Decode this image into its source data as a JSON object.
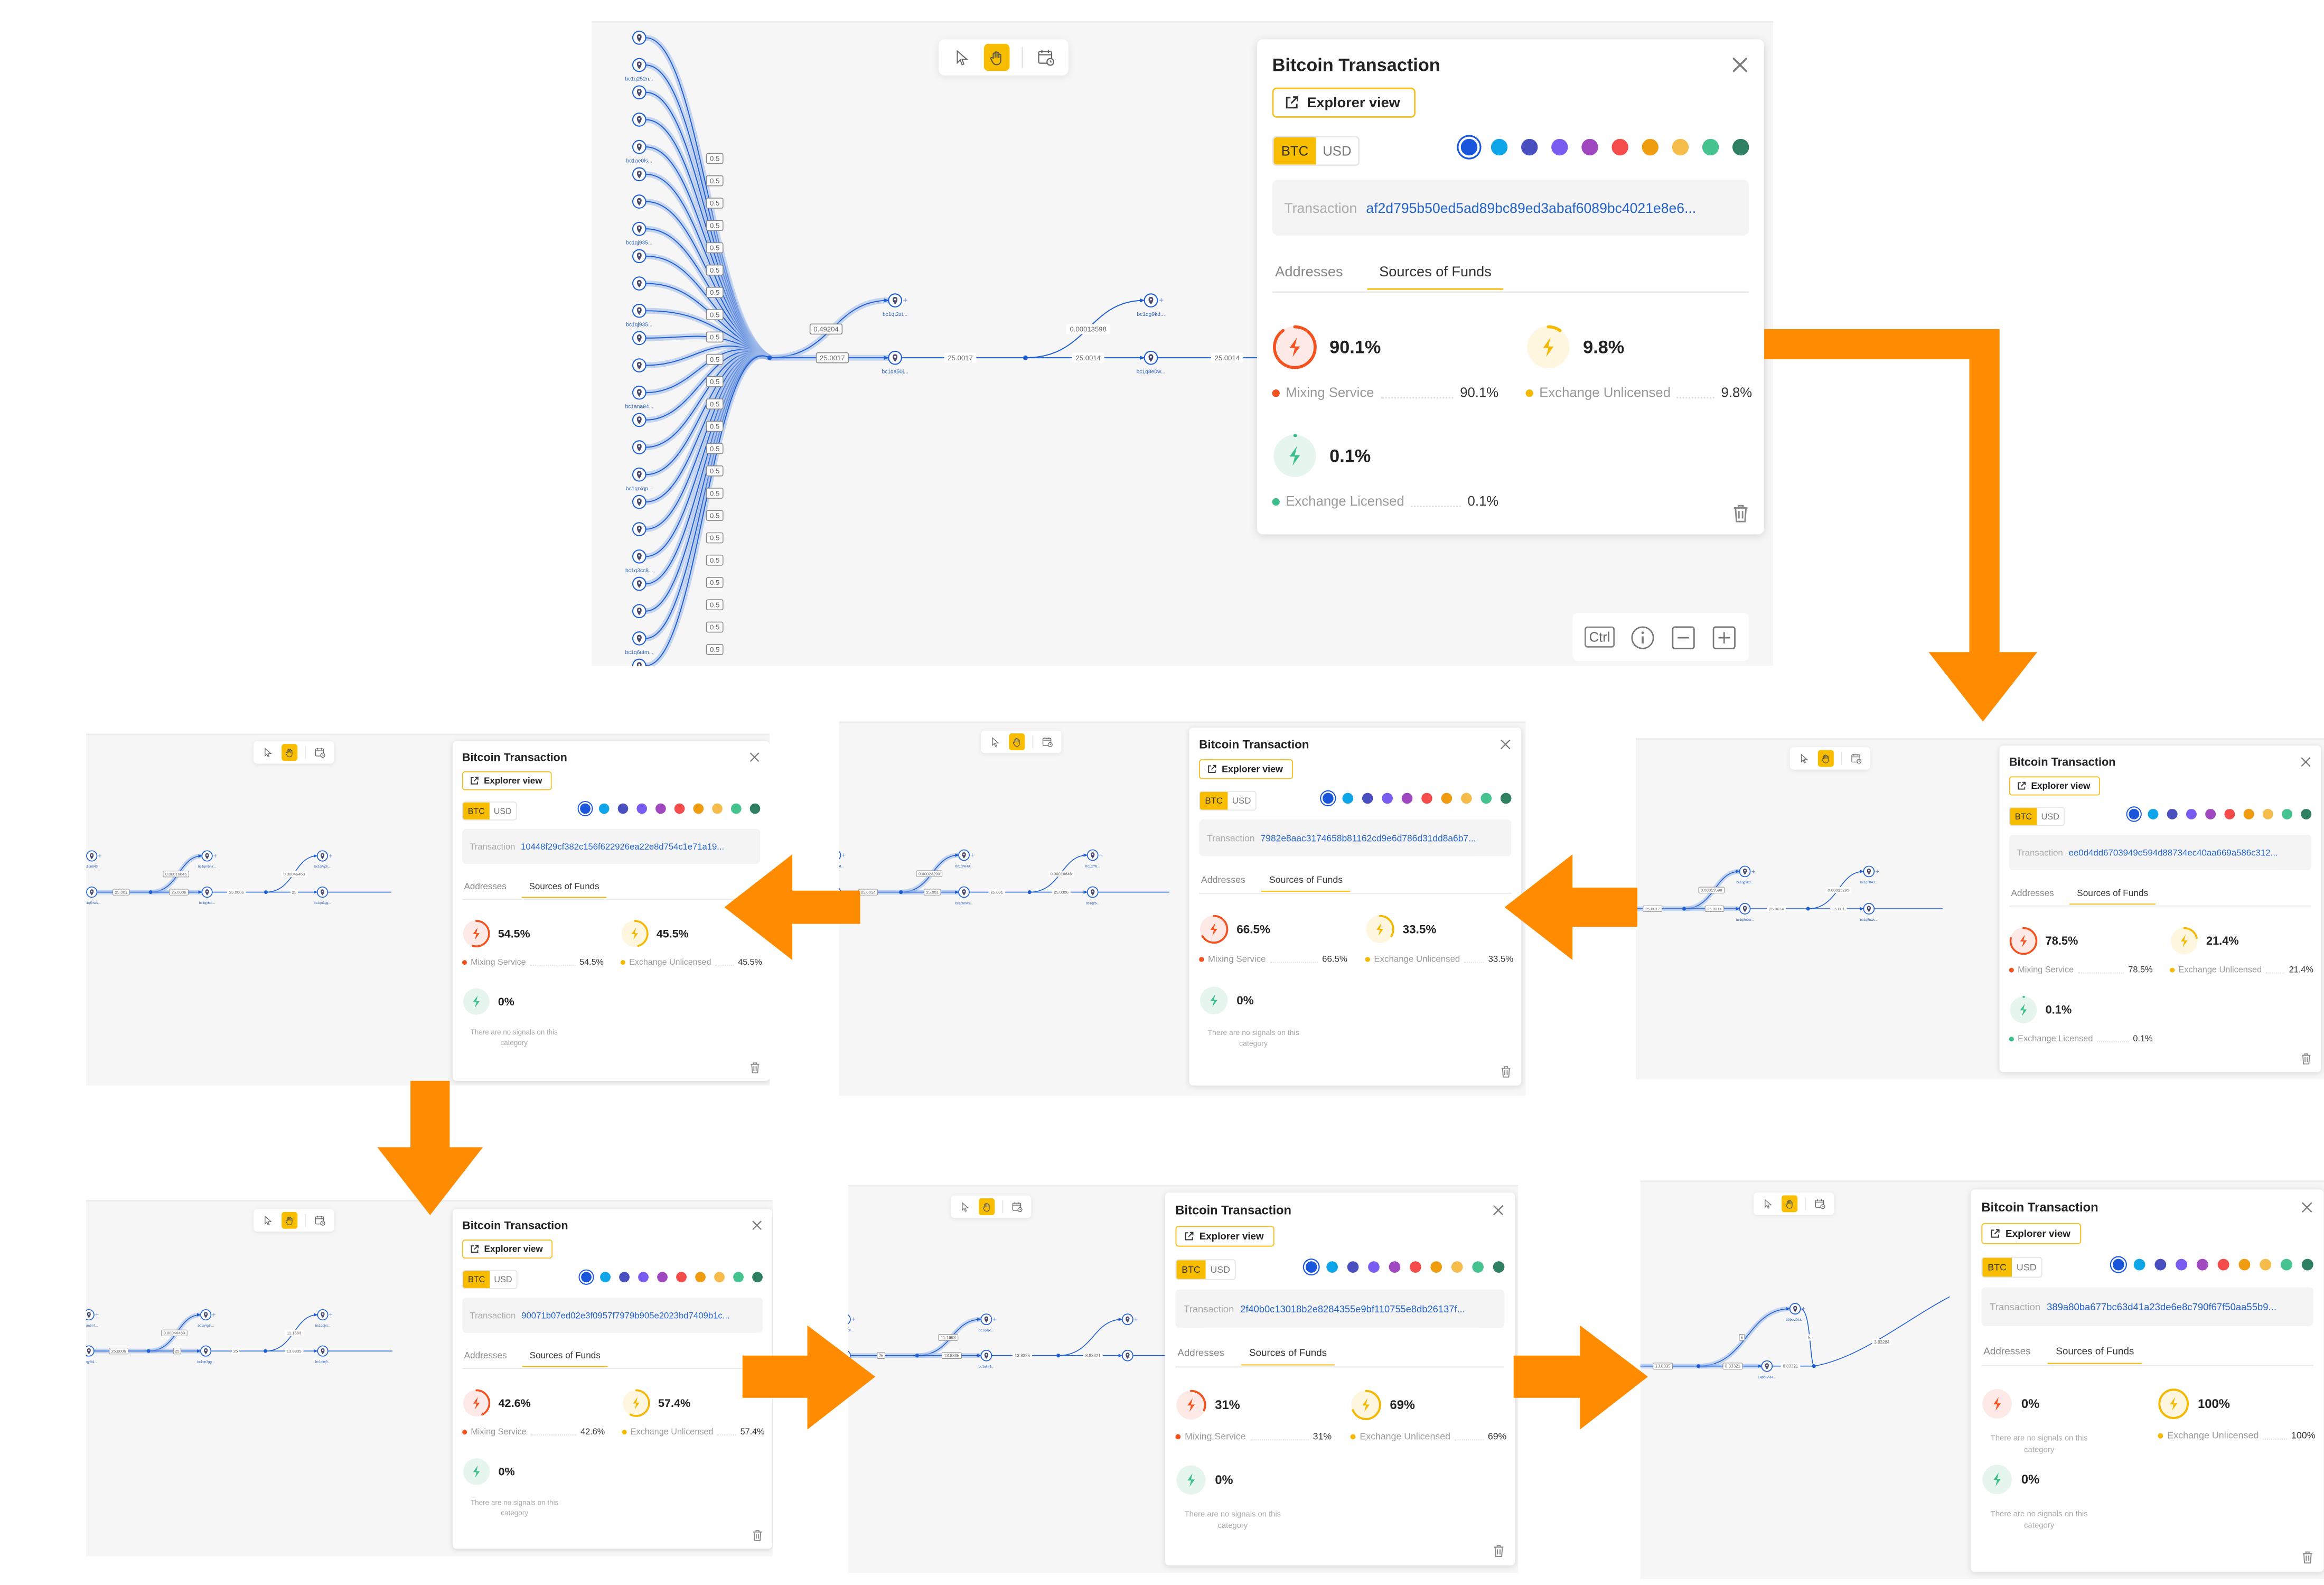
{
  "card": {
    "title": "Bitcoin Transaction",
    "explorer_label": "Explorer view",
    "currency_options": [
      "BTC",
      "USD"
    ],
    "selected_currency": "BTC",
    "tx_label": "Transaction",
    "tabs": [
      "Addresses",
      "Sources of Funds"
    ],
    "active_tab": "Sources of Funds",
    "empty_message": "There are no signals on this category",
    "category_names": {
      "mixing": "Mixing Service",
      "unlicensed": "Exchange Unlicensed",
      "licensed": "Exchange Licensed"
    },
    "swatch_colors": [
      "#1a56db",
      "#0ea5e9",
      "#4a4fc0",
      "#7a5cf0",
      "#a048c0",
      "#f44b4b",
      "#f09c10",
      "#f5bc4c",
      "#45c490",
      "#2e8060"
    ]
  },
  "colors": {
    "mixing": "#f4511e",
    "mixing_bg": "#fdeae6",
    "unlicensed": "#f5b800",
    "unlicensed_bg": "#fff6e0",
    "licensed": "#3dbf8a",
    "licensed_bg": "#e6f6ef",
    "edge": "#1f5fcf",
    "arrow": "#ff8c00",
    "accent": "#f9bd00"
  },
  "toolbar": {
    "icons": [
      "cursor-icon",
      "hand-icon",
      "calendar-clock-icon"
    ],
    "active": "hand-icon"
  },
  "zoom_controls": {
    "ctrl_label": "Ctrl",
    "icons": [
      "info-icon",
      "zoom-out-icon",
      "zoom-in-icon"
    ]
  },
  "panels": [
    {
      "tx_hash": "af2d795b50ed5ad89bc89ed3abaf6089bc4021e8e6...",
      "categories": [
        {
          "key": "mixing",
          "pct": "90.1%"
        },
        {
          "key": "unlicensed",
          "pct": "9.8%"
        },
        {
          "key": "licensed",
          "pct": "0.1%"
        }
      ],
      "graph": {
        "fan": {
          "count": 24,
          "edge_label": "0.5",
          "labels": [
            "bc1q252n...",
            "bc1ae0ls...",
            "bc1qj935...",
            "bc1ana94...",
            "bc1qrxqp...",
            "bc1q3cc8...",
            "bc1q6utm..."
          ]
        },
        "branch1": "0.49204",
        "node1_top": "bc1qt2zt...",
        "main1": "25.0017",
        "node1": "bc1qa50j...",
        "mid": "25.0017",
        "branch2": "0.00013598",
        "node2_top": "bc1qg9kd...",
        "main2": "25.0014",
        "node2": "bc1q8e0w...",
        "out": "25.0014"
      }
    },
    {
      "tx_hash": "10448f29cf382c156f622926ea22e8d754c1e71a19...",
      "categories": [
        {
          "key": "mixing",
          "pct": "54.5%"
        },
        {
          "key": "unlicensed",
          "pct": "45.5%"
        },
        {
          "key": "licensed",
          "pct": "0%"
        }
      ],
      "graph": {
        "prev_top": "bc1qn843...",
        "prev": "bc1q5nws...",
        "in": "25.001",
        "branch1": "0.00016646",
        "node1_top": "bc1qm5n7...",
        "main1": "25.0006",
        "node1": "bc1qy6t4...",
        "mid": "25.0006",
        "branch2": "0.00046463",
        "node2_top": "bc1q4g3l...",
        "main2": "25",
        "node2": "bc1qn3gg..."
      }
    },
    {
      "tx_hash": "7982e8aac3174658b81162cd9e6d786d31dd8a6b7...",
      "categories": [
        {
          "key": "mixing",
          "pct": "66.5%"
        },
        {
          "key": "unlicensed",
          "pct": "33.5%"
        },
        {
          "key": "licensed",
          "pct": "0%"
        }
      ],
      "graph": {
        "prev_top": "bc1qg9kd...",
        "prev": "bc1q8e0w...",
        "in": "25.0014",
        "branch1": "0.00023293",
        "node1_top": "bc1qn843...",
        "main1": "25.001",
        "node1": "bc1q5nws...",
        "mid": "25.001",
        "branch2": "0.00016646",
        "node2_top": "bc1qm5...",
        "main2": "25.0006",
        "node2": "bc1qy6..."
      }
    },
    {
      "tx_hash": "ee0d4dd6703949e594d88734ec40aa669a586c312...",
      "categories": [
        {
          "key": "mixing",
          "pct": "78.5%"
        },
        {
          "key": "unlicensed",
          "pct": "21.4%"
        },
        {
          "key": "licensed",
          "pct": "0.1%"
        }
      ],
      "graph": {
        "in": "25.0017",
        "branch1": "0.00013598",
        "node1_top": "bc1qg9kd...",
        "main1": "25.0014",
        "node1": "bc1q8e0w...",
        "mid": "25.0014",
        "branch2": "0.00023293",
        "node2_top": "bc1qn843...",
        "main2": "25.001",
        "node2": "bc1q5nws..."
      }
    },
    {
      "tx_hash": "90071b07ed02e3f0957f7979b905e2023bd7409b1c...",
      "categories": [
        {
          "key": "mixing",
          "pct": "42.6%"
        },
        {
          "key": "unlicensed",
          "pct": "57.4%"
        },
        {
          "key": "licensed",
          "pct": "0%"
        }
      ],
      "graph": {
        "prev_top": "bc1qm5n7...",
        "prev": "bc1qy6t4...",
        "in": "25.0006",
        "branch1": "0.00046463",
        "node1_top": "bc1q4g3l...",
        "main1": "25",
        "node1": "bc1qn3gg...",
        "mid": "25",
        "branch2": "11.1663",
        "node2_top": "bc1qdjxl...",
        "main2": "13.8335",
        "node2": "bc1qlnj9..."
      }
    },
    {
      "tx_hash": "2f40b0c13018b2e8284355e9bf110755e8db26137f...",
      "categories": [
        {
          "key": "mixing",
          "pct": "31%"
        },
        {
          "key": "unlicensed",
          "pct": "69%"
        },
        {
          "key": "licensed",
          "pct": "0%"
        }
      ],
      "graph": {
        "prev_top": "bc1q4g3l...",
        "prev": "bc1qn3gg...",
        "in": "25",
        "branch1": "11.1663",
        "node1_top": "bc1qdjxl...",
        "main1": "13.8335",
        "node1": "bc1qlnj9...",
        "mid": "13.8335",
        "main2": "8.83321"
      }
    },
    {
      "tx_hash": "389a80ba677bc63d41a23de6e8c790f67f50aa55b9...",
      "categories": [
        {
          "key": "mixing",
          "pct": "0%"
        },
        {
          "key": "unlicensed",
          "pct": "100%"
        },
        {
          "key": "licensed",
          "pct": "0%"
        }
      ],
      "graph": {
        "in": "13.8335",
        "branch1": "5",
        "node1_top": "399ovDLk...",
        "main1": "8.83321",
        "node1": "14pcFAJ4...",
        "mid": "8.83321",
        "merge": "5",
        "out": "3.83284"
      }
    }
  ]
}
